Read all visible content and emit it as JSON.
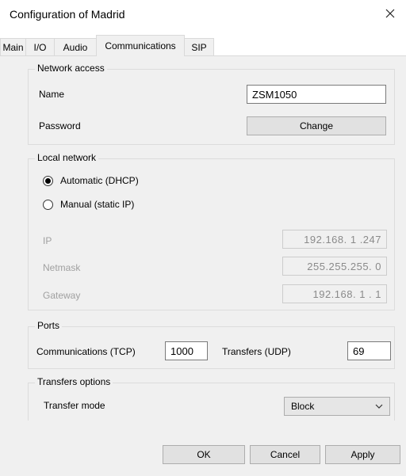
{
  "window": {
    "title": "Configuration of Madrid",
    "close_icon": "close-icon"
  },
  "tabs": [
    {
      "label": "Main",
      "active": false
    },
    {
      "label": "I/O",
      "active": false
    },
    {
      "label": "Audio",
      "active": false
    },
    {
      "label": "Communications",
      "active": true
    },
    {
      "label": "SIP",
      "active": false
    }
  ],
  "network_access": {
    "legend": "Network access",
    "name_label": "Name",
    "name_value": "ZSM1050",
    "password_label": "Password",
    "change_button": "Change"
  },
  "local_network": {
    "legend": "Local network",
    "automatic_label": "Automatic (DHCP)",
    "automatic_selected": true,
    "manual_label": "Manual (static IP)",
    "manual_selected": false,
    "ip_label": "IP",
    "ip_value": "192.168.  1 .247",
    "netmask_label": "Netmask",
    "netmask_value": "255.255.255.  0",
    "gateway_label": "Gateway",
    "gateway_value": "192.168.  1 .  1"
  },
  "ports": {
    "legend": "Ports",
    "tcp_label": "Communications (TCP)",
    "tcp_value": "1000",
    "udp_label": "Transfers (UDP)",
    "udp_value": "69"
  },
  "transfers_options": {
    "legend": "Transfers options",
    "mode_label": "Transfer mode",
    "mode_value": "Block"
  },
  "footer": {
    "ok": "OK",
    "cancel": "Cancel",
    "apply": "Apply"
  },
  "colors": {
    "panel": "#f0f0f0",
    "button": "#e1e1e1",
    "border": "#adadad"
  }
}
